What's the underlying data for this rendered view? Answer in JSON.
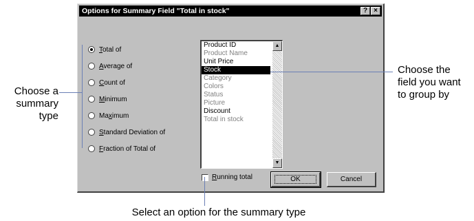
{
  "dialog": {
    "title": "Options for Summary Field \"Total in stock\"",
    "help_label": "?",
    "close_label": "×",
    "summary_options": [
      {
        "accel": "T",
        "rest": "otal of",
        "selected": true
      },
      {
        "accel": "A",
        "rest": "verage of",
        "selected": false
      },
      {
        "accel": "C",
        "rest": "ount of",
        "selected": false
      },
      {
        "accel": "M",
        "rest": "inimum",
        "selected": false
      },
      {
        "pre": "Ma",
        "accel": "x",
        "rest": "imum",
        "selected": false
      },
      {
        "accel": "S",
        "rest": "tandard Deviation of",
        "selected": false
      },
      {
        "accel": "F",
        "rest": "raction of Total of",
        "selected": false
      }
    ],
    "fields": [
      {
        "label": "Product ID",
        "state": "normal"
      },
      {
        "label": "Product Name",
        "state": "dim"
      },
      {
        "label": "Unit Price",
        "state": "normal"
      },
      {
        "label": "Stock",
        "state": "selected"
      },
      {
        "label": "Category",
        "state": "dim"
      },
      {
        "label": "Colors",
        "state": "dim"
      },
      {
        "label": "Status",
        "state": "dim"
      },
      {
        "label": "Picture",
        "state": "dim"
      },
      {
        "label": "Discount",
        "state": "normal"
      },
      {
        "label": "Total in stock",
        "state": "dim"
      }
    ],
    "running_total": {
      "accel": "R",
      "rest": "unning total",
      "checked": false
    },
    "ok_label": "OK",
    "cancel_label": "Cancel"
  },
  "callouts": {
    "left": [
      "Choose a",
      "summary",
      "type"
    ],
    "right": [
      "Choose the",
      "field you want",
      "to group by"
    ],
    "bottom": "Select an option for the summary type"
  },
  "colors": {
    "dialog_gray": "#c0c0c0",
    "callout_line": "#6a7fb5",
    "selection": "#000000"
  }
}
